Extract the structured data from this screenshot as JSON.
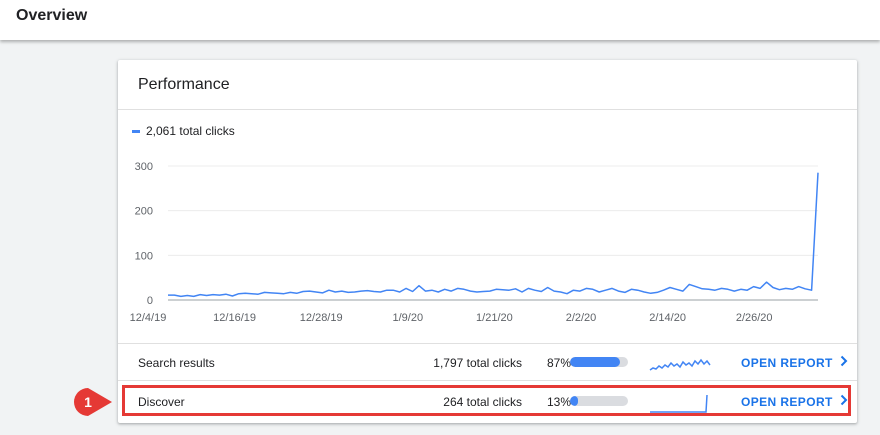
{
  "header": {
    "title": "Overview"
  },
  "card": {
    "title": "Performance"
  },
  "legend": {
    "label": "2,061 total clicks",
    "color": "#4285f4"
  },
  "chart_data": {
    "type": "line",
    "series": [
      {
        "name": "2,061 total clicks",
        "values": [
          11,
          11,
          8,
          10,
          8,
          12,
          10,
          12,
          11,
          13,
          9,
          14,
          15,
          14,
          13,
          17,
          16,
          15,
          14,
          17,
          15,
          19,
          20,
          18,
          16,
          22,
          18,
          20,
          17,
          18,
          20,
          21,
          19,
          18,
          22,
          22,
          18,
          26,
          19,
          32,
          20,
          22,
          18,
          24,
          20,
          26,
          24,
          20,
          18,
          19,
          20,
          24,
          23,
          22,
          25,
          18,
          26,
          22,
          19,
          28,
          20,
          18,
          14,
          22,
          20,
          26,
          24,
          18,
          22,
          26,
          20,
          17,
          24,
          22,
          18,
          15,
          17,
          22,
          28,
          24,
          20,
          35,
          30,
          25,
          24,
          22,
          26,
          24,
          20,
          24,
          22,
          30,
          26,
          40,
          28,
          23,
          26,
          24,
          30,
          25,
          22,
          285
        ]
      }
    ],
    "x_tick_labels": [
      "12/4/19",
      "12/16/19",
      "12/28/19",
      "1/9/20",
      "1/21/20",
      "2/2/20",
      "2/14/20",
      "2/26/20"
    ],
    "y_tick_labels": [
      "300",
      "200",
      "100",
      "0"
    ],
    "ylim": [
      0,
      300
    ],
    "grid": true
  },
  "rows": [
    {
      "label": "Search results",
      "clicks": "1,797 total clicks",
      "pct_label": "87%",
      "share": 0.87,
      "open": "OPEN REPORT"
    },
    {
      "label": "Discover",
      "clicks": "264 total clicks",
      "pct_label": "13%",
      "share": 0.13,
      "open": "OPEN REPORT"
    }
  ],
  "badge": {
    "number": "1",
    "color": "#e53935"
  },
  "colors": {
    "accent": "#4285f4",
    "link": "#1a73e8",
    "highlight": "#e53935"
  }
}
